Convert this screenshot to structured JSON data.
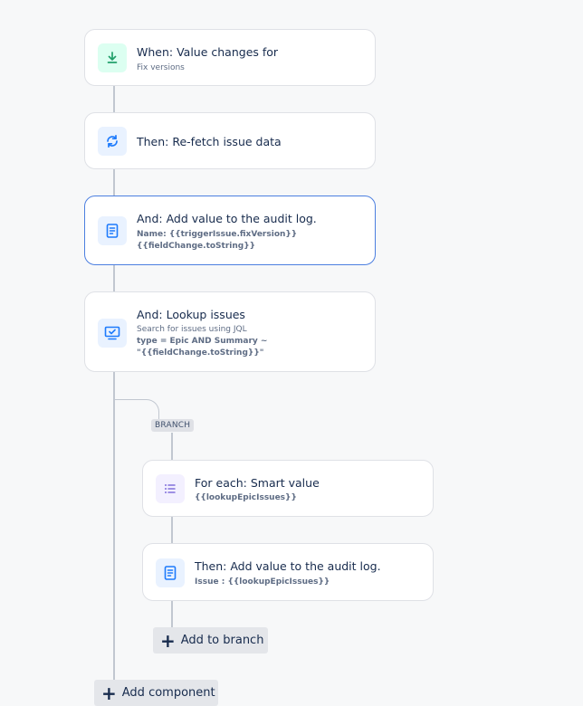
{
  "trigger": {
    "icon": "download-icon",
    "title": "When: Value changes for",
    "subtitle": "Fix versions",
    "accent": "#22a06b"
  },
  "refetch": {
    "icon": "refresh-icon",
    "title": "Then: Re-fetch issue data",
    "accent": "#1d7afc"
  },
  "audit_log": {
    "icon": "document-icon",
    "title": "And: Add value to the audit log.",
    "line1": "Name: {{triggerIssue.fixVersion}}",
    "line2": "{{fieldChange.toString}}"
  },
  "lookup": {
    "icon": "monitor-check-icon",
    "title": "And: Lookup issues",
    "subtitle": "Search for issues using JQL",
    "line1": "type = Epic AND Summary ~",
    "line2": "\"{{fieldChange.toString}}\""
  },
  "branch": {
    "tag": "BRANCH",
    "for_each": {
      "icon": "list-icon",
      "title": "For each: Smart value",
      "line1": "{{lookupEpicIssues}}",
      "accent": "#8270db"
    },
    "audit_log": {
      "icon": "document-icon",
      "title": "Then: Add value to the audit log.",
      "line1": "Issue : {{lookupEpicIssues}}"
    },
    "add_label": "Add to branch"
  },
  "add_component_label": "Add component"
}
